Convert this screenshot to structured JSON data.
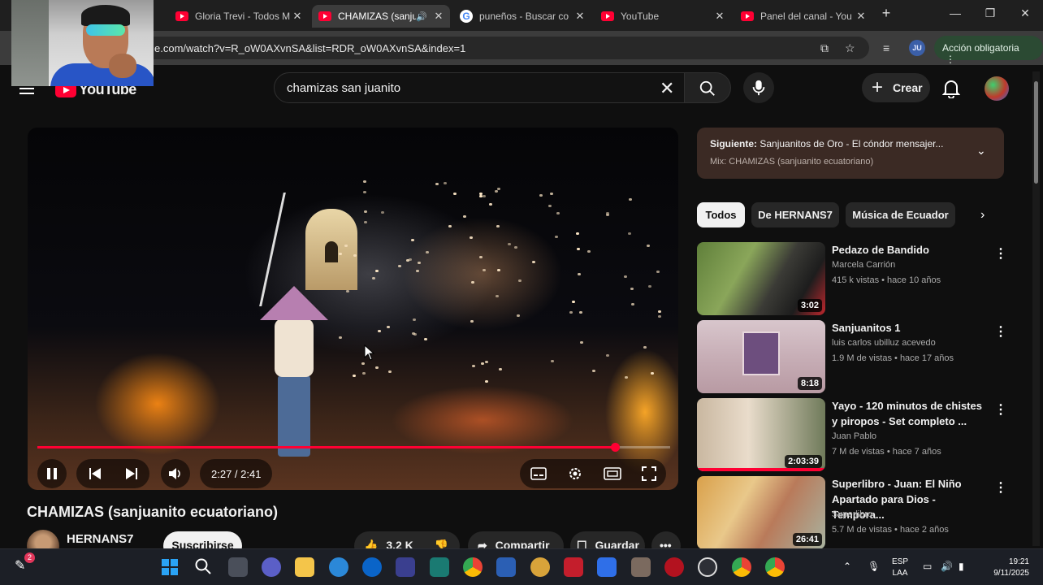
{
  "browser": {
    "tabs": [
      {
        "title": "Gloria Trevi - Todos M",
        "icon": "youtube-favicon"
      },
      {
        "title": "CHAMIZAS (sanju",
        "icon": "youtube-favicon",
        "audio": "🔊"
      },
      {
        "title": "puneños - Buscar co",
        "icon": "google-favicon"
      },
      {
        "title": "YouTube",
        "icon": "youtube-favicon"
      },
      {
        "title": "Panel del canal - You",
        "icon": "youtube-favicon"
      }
    ],
    "url": "e.com/watch?v=R_oW0AXvnSA&list=RDR_oW0AXvnSA&index=1",
    "profile_initials": "JU",
    "action_label": "Acción obligatoria"
  },
  "youtube": {
    "logo_text": "YouTube",
    "search_value": "chamizas san juanito",
    "create_label": "Crear"
  },
  "player": {
    "current_time": "2:27",
    "duration": "2:41",
    "time_display": "2:27 / 2:41",
    "progress_fraction": 0.913,
    "buffer_fraction": 1.0
  },
  "video": {
    "title": "CHAMIZAS (sanjuanito ecuatoriano)",
    "channel": "HERNANS7",
    "subscribe_label": "Suscribirse",
    "likes": "3.2 K",
    "share_label": "Compartir",
    "save_label": "Guardar"
  },
  "up_next": {
    "label": "Siguiente:",
    "title": "Sanjuanitos de Oro - El cóndor mensajer...",
    "mix": "Mix: CHAMIZAS (sanjuanito ecuatoriano)"
  },
  "chips": [
    "Todos",
    "De HERNANS7",
    "Música de Ecuador"
  ],
  "recommendations": [
    {
      "title": "Pedazo de Bandido",
      "channel": "Marcela Carrión",
      "meta": "415 k vistas • hace 10 años",
      "duration": "3:02"
    },
    {
      "title": "Sanjuanitos 1",
      "channel": "luis carlos ubilluz acevedo",
      "meta": "1.9 M de vistas • hace 17 años",
      "duration": "8:18"
    },
    {
      "title": "Yayo - 120 minutos de chistes y piropos - Set completo ...",
      "channel": "Juan Pablo",
      "meta": "7 M de vistas • hace 7 años",
      "duration": "2:03:39"
    },
    {
      "title": "Superlibro - Juan: El Niño Apartado para Dios -Tempora...",
      "channel": "Superlibro",
      "meta": "5.7 M de vistas • hace 2 años",
      "duration": "26:41"
    }
  ],
  "taskbar": {
    "lang_line1": "ESP",
    "lang_line2": "LAA",
    "time": "19:21",
    "date": "9/11/2025",
    "notification_badge": "2"
  }
}
